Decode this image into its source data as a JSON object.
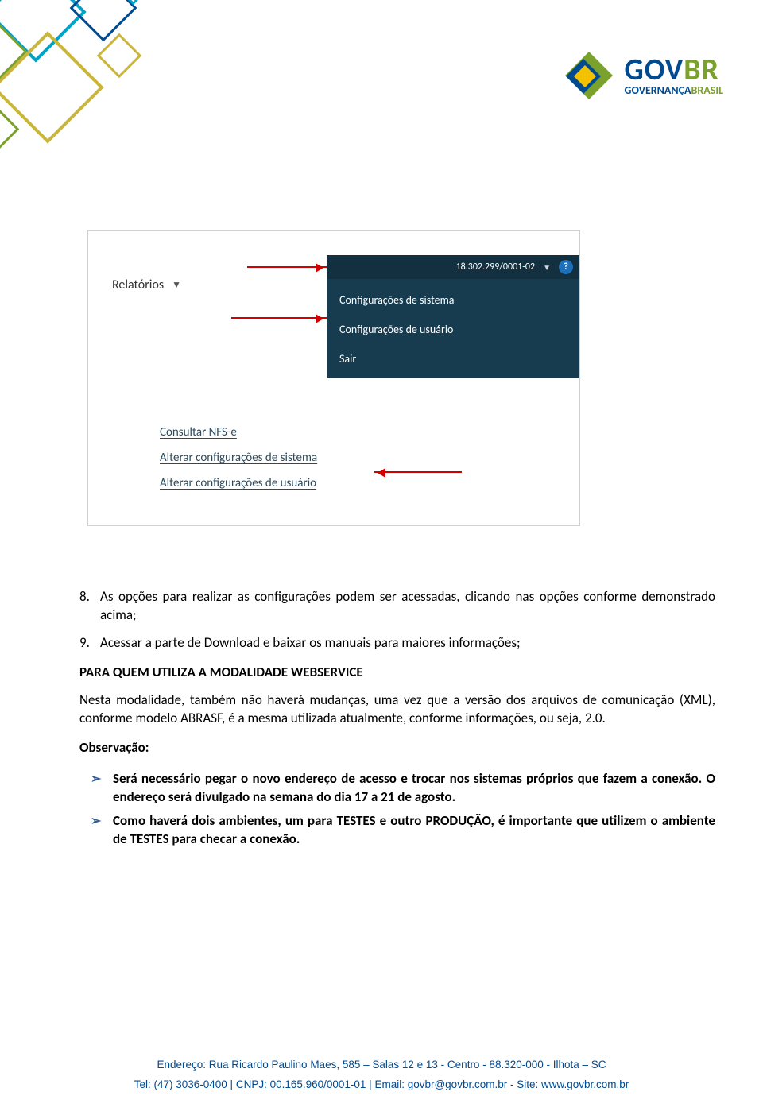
{
  "logo": {
    "text_gov": "GOV",
    "text_br": "BR",
    "subtitle_a": "GOVERNANÇA",
    "subtitle_b": "BRASIL"
  },
  "screenshot": {
    "cnpj": "18.302.299/0001-02",
    "help_label": "?",
    "menu": {
      "config_sistema": "Configurações de sistema",
      "config_usuario": "Configurações de usuário",
      "sair": "Sair"
    },
    "relatorios_label": "Relatórios",
    "links": {
      "consultar_nfse": "Consultar NFS-e",
      "alterar_sistema": "Alterar configurações de sistema",
      "alterar_usuario": "Alterar configurações de usuário"
    }
  },
  "list": {
    "item8_num": "8.",
    "item8_text": "As opções para realizar as configurações podem ser acessadas, clicando nas opções conforme demonstrado acima;",
    "item9_num": "9.",
    "item9_text": "Acessar a parte de Download e baixar os manuais para maiores informações;"
  },
  "heading_webservice": "PARA QUEM UTILIZA A MODALIDADE WEBSERVICE",
  "para_webservice": "Nesta modalidade, também não haverá mudanças, uma vez que a versão dos arquivos de comunicação (XML), conforme modelo ABRASF, é a mesma utilizada atualmente, conforme informações, ou seja, 2.0.",
  "observacao_label": "Observação:",
  "bullets": {
    "b1": "Será necessário pegar o novo endereço de acesso e trocar nos sistemas próprios que fazem a conexão.  O endereço será divulgado na semana do dia 17 a 21 de agosto.",
    "b2": "Como haverá dois ambientes, um para TESTES e outro PRODUÇÃO, é importante que utilizem o ambiente de TESTES para checar a conexão."
  },
  "footer": {
    "line1": "Endereço: Rua Ricardo Paulino Maes, 585 – Salas 12 e 13 - Centro - 88.320-000 - Ilhota – SC",
    "line2": "Tel: (47) 3036-0400 | CNPJ: 00.165.960/0001-01 | Email: govbr@govbr.com.br - Site: www.govbr.com.br"
  }
}
